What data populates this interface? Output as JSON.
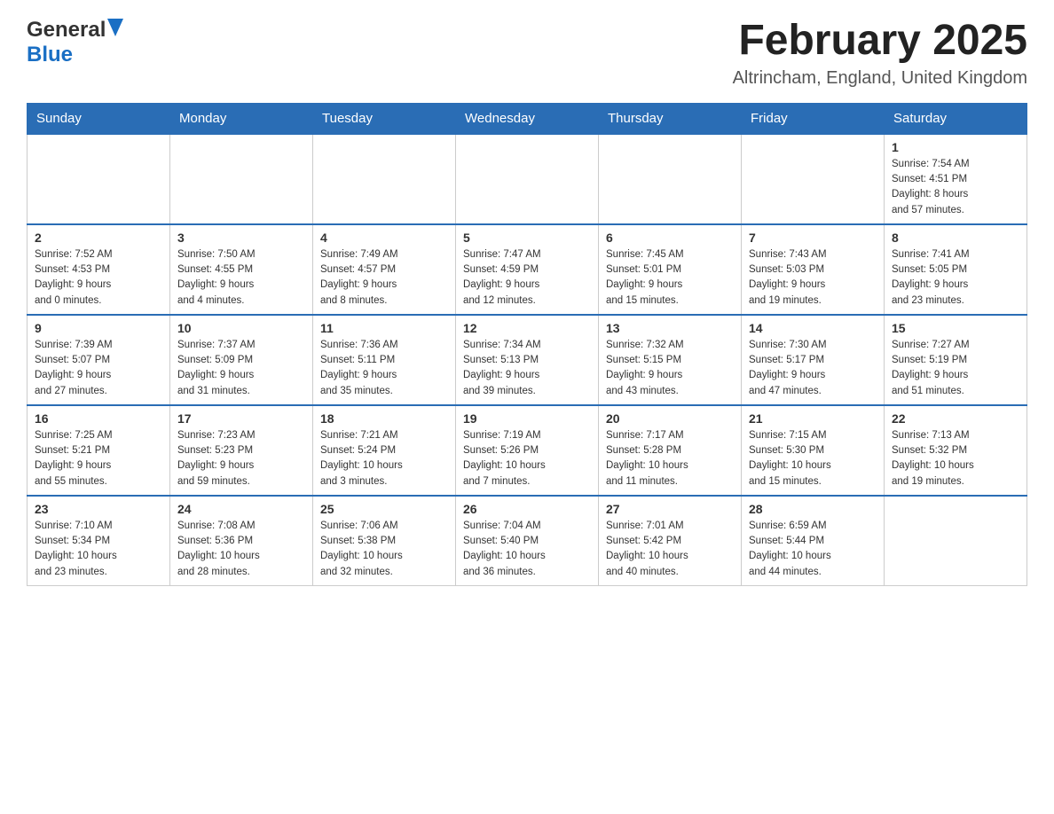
{
  "header": {
    "logo_general": "General",
    "logo_blue": "Blue",
    "month_title": "February 2025",
    "location": "Altrincham, England, United Kingdom"
  },
  "days_of_week": [
    "Sunday",
    "Monday",
    "Tuesday",
    "Wednesday",
    "Thursday",
    "Friday",
    "Saturday"
  ],
  "weeks": [
    [
      {
        "day": "",
        "info": ""
      },
      {
        "day": "",
        "info": ""
      },
      {
        "day": "",
        "info": ""
      },
      {
        "day": "",
        "info": ""
      },
      {
        "day": "",
        "info": ""
      },
      {
        "day": "",
        "info": ""
      },
      {
        "day": "1",
        "info": "Sunrise: 7:54 AM\nSunset: 4:51 PM\nDaylight: 8 hours\nand 57 minutes."
      }
    ],
    [
      {
        "day": "2",
        "info": "Sunrise: 7:52 AM\nSunset: 4:53 PM\nDaylight: 9 hours\nand 0 minutes."
      },
      {
        "day": "3",
        "info": "Sunrise: 7:50 AM\nSunset: 4:55 PM\nDaylight: 9 hours\nand 4 minutes."
      },
      {
        "day": "4",
        "info": "Sunrise: 7:49 AM\nSunset: 4:57 PM\nDaylight: 9 hours\nand 8 minutes."
      },
      {
        "day": "5",
        "info": "Sunrise: 7:47 AM\nSunset: 4:59 PM\nDaylight: 9 hours\nand 12 minutes."
      },
      {
        "day": "6",
        "info": "Sunrise: 7:45 AM\nSunset: 5:01 PM\nDaylight: 9 hours\nand 15 minutes."
      },
      {
        "day": "7",
        "info": "Sunrise: 7:43 AM\nSunset: 5:03 PM\nDaylight: 9 hours\nand 19 minutes."
      },
      {
        "day": "8",
        "info": "Sunrise: 7:41 AM\nSunset: 5:05 PM\nDaylight: 9 hours\nand 23 minutes."
      }
    ],
    [
      {
        "day": "9",
        "info": "Sunrise: 7:39 AM\nSunset: 5:07 PM\nDaylight: 9 hours\nand 27 minutes."
      },
      {
        "day": "10",
        "info": "Sunrise: 7:37 AM\nSunset: 5:09 PM\nDaylight: 9 hours\nand 31 minutes."
      },
      {
        "day": "11",
        "info": "Sunrise: 7:36 AM\nSunset: 5:11 PM\nDaylight: 9 hours\nand 35 minutes."
      },
      {
        "day": "12",
        "info": "Sunrise: 7:34 AM\nSunset: 5:13 PM\nDaylight: 9 hours\nand 39 minutes."
      },
      {
        "day": "13",
        "info": "Sunrise: 7:32 AM\nSunset: 5:15 PM\nDaylight: 9 hours\nand 43 minutes."
      },
      {
        "day": "14",
        "info": "Sunrise: 7:30 AM\nSunset: 5:17 PM\nDaylight: 9 hours\nand 47 minutes."
      },
      {
        "day": "15",
        "info": "Sunrise: 7:27 AM\nSunset: 5:19 PM\nDaylight: 9 hours\nand 51 minutes."
      }
    ],
    [
      {
        "day": "16",
        "info": "Sunrise: 7:25 AM\nSunset: 5:21 PM\nDaylight: 9 hours\nand 55 minutes."
      },
      {
        "day": "17",
        "info": "Sunrise: 7:23 AM\nSunset: 5:23 PM\nDaylight: 9 hours\nand 59 minutes."
      },
      {
        "day": "18",
        "info": "Sunrise: 7:21 AM\nSunset: 5:24 PM\nDaylight: 10 hours\nand 3 minutes."
      },
      {
        "day": "19",
        "info": "Sunrise: 7:19 AM\nSunset: 5:26 PM\nDaylight: 10 hours\nand 7 minutes."
      },
      {
        "day": "20",
        "info": "Sunrise: 7:17 AM\nSunset: 5:28 PM\nDaylight: 10 hours\nand 11 minutes."
      },
      {
        "day": "21",
        "info": "Sunrise: 7:15 AM\nSunset: 5:30 PM\nDaylight: 10 hours\nand 15 minutes."
      },
      {
        "day": "22",
        "info": "Sunrise: 7:13 AM\nSunset: 5:32 PM\nDaylight: 10 hours\nand 19 minutes."
      }
    ],
    [
      {
        "day": "23",
        "info": "Sunrise: 7:10 AM\nSunset: 5:34 PM\nDaylight: 10 hours\nand 23 minutes."
      },
      {
        "day": "24",
        "info": "Sunrise: 7:08 AM\nSunset: 5:36 PM\nDaylight: 10 hours\nand 28 minutes."
      },
      {
        "day": "25",
        "info": "Sunrise: 7:06 AM\nSunset: 5:38 PM\nDaylight: 10 hours\nand 32 minutes."
      },
      {
        "day": "26",
        "info": "Sunrise: 7:04 AM\nSunset: 5:40 PM\nDaylight: 10 hours\nand 36 minutes."
      },
      {
        "day": "27",
        "info": "Sunrise: 7:01 AM\nSunset: 5:42 PM\nDaylight: 10 hours\nand 40 minutes."
      },
      {
        "day": "28",
        "info": "Sunrise: 6:59 AM\nSunset: 5:44 PM\nDaylight: 10 hours\nand 44 minutes."
      },
      {
        "day": "",
        "info": ""
      }
    ]
  ]
}
